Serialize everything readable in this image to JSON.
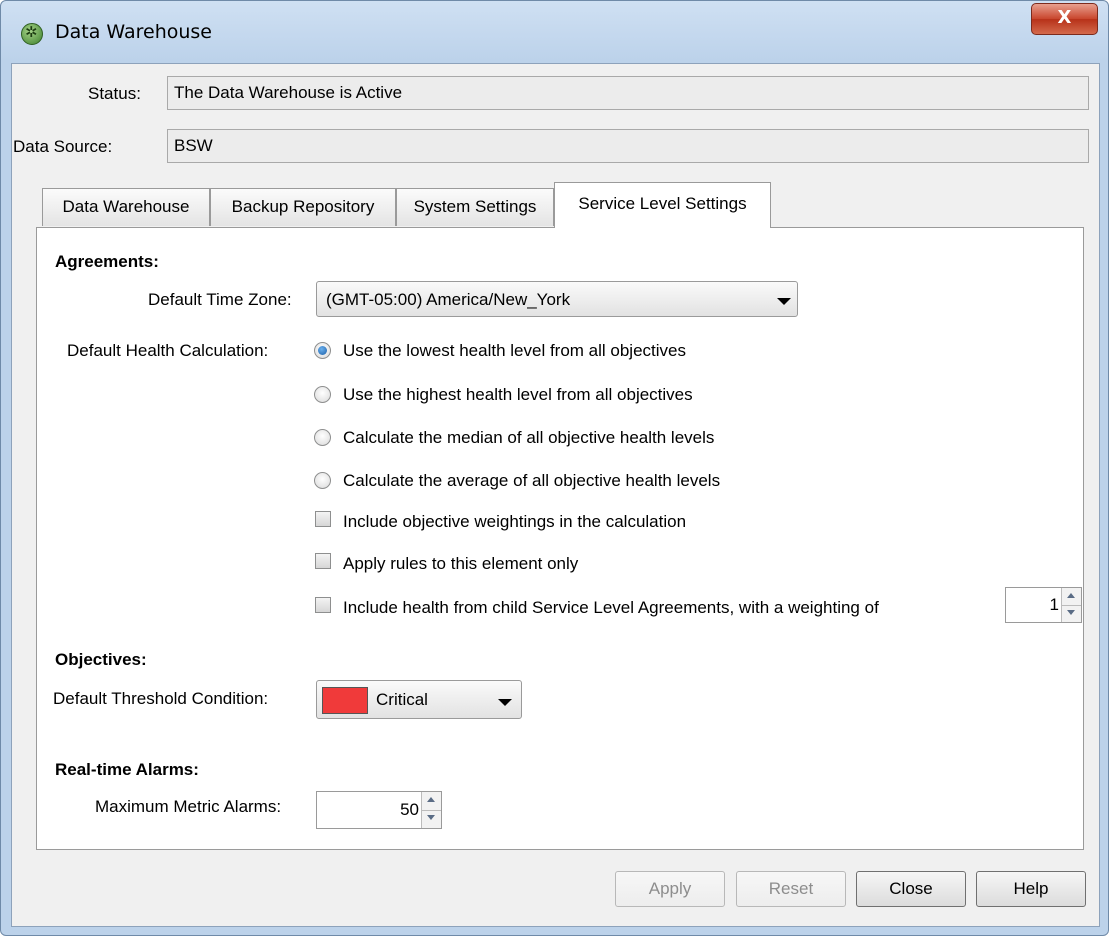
{
  "window": {
    "title": "Data Warehouse",
    "close_glyph": "X"
  },
  "status": {
    "label": "Status:",
    "value": "The Data Warehouse is Active"
  },
  "data_source": {
    "label": "Data Source:",
    "value": "BSW"
  },
  "tabs": [
    {
      "label": "Data Warehouse"
    },
    {
      "label": "Backup Repository"
    },
    {
      "label": "System Settings"
    },
    {
      "label": "Service Level Settings",
      "active": true
    }
  ],
  "agreements": {
    "heading": "Agreements:",
    "timezone_label": "Default Time Zone:",
    "timezone_value": "(GMT-05:00) America/New_York",
    "health_label": "Default Health Calculation:",
    "radio_options": [
      "Use the lowest health level from all objectives",
      "Use the highest health level from all objectives",
      "Calculate the median of all objective health levels",
      "Calculate the average of all objective health levels"
    ],
    "selected_option": 0,
    "checkboxes": [
      "Include objective weightings in the calculation",
      "Apply rules to this element only",
      "Include health from child Service Level Agreements, with a weighting of"
    ],
    "weighting_value": "1"
  },
  "objectives": {
    "heading": "Objectives:",
    "threshold_label": "Default Threshold Condition:",
    "threshold_value": "Critical",
    "threshold_color": "#f03a3a"
  },
  "alarms": {
    "heading": "Real-time Alarms:",
    "max_label": "Maximum Metric Alarms:",
    "max_value": "50"
  },
  "buttons": {
    "apply": "Apply",
    "reset": "Reset",
    "close": "Close",
    "help": "Help"
  }
}
